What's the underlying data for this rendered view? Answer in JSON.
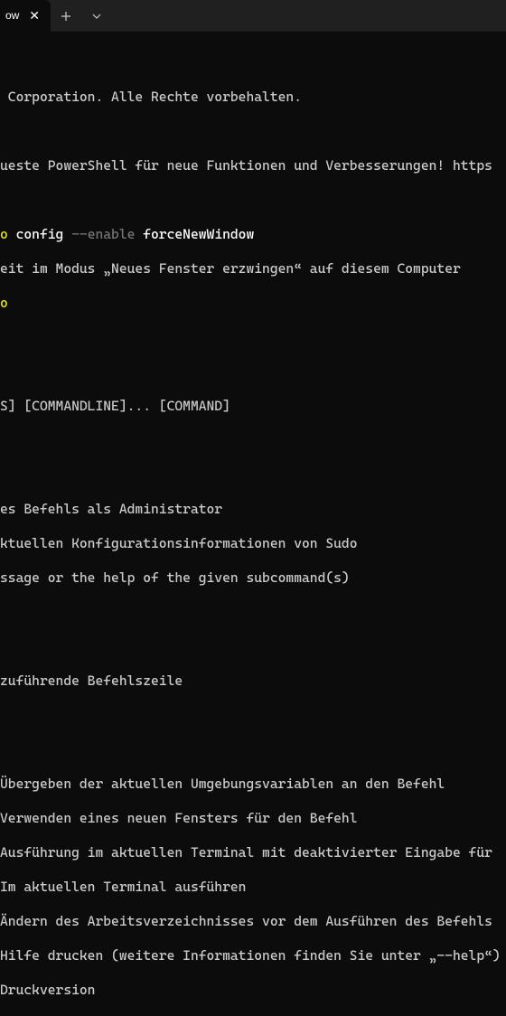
{
  "tab": {
    "title": "owe",
    "close_glyph": "✕"
  },
  "lines": {
    "l1": " Corporation. Alle Rechte vorbehalten.",
    "l2a": "ueste PowerShell für neue Funktionen und Verbesserungen! https",
    "l3_a": "o",
    "l3_b": " config ",
    "l3_c": "--enable",
    "l3_d": " forceNewWindow",
    "l4": "eit im Modus „Neues Fenster erzwingen“ auf diesem Computer",
    "l5": "o",
    "l6": "S] [COMMANDLINE]... [COMMAND]",
    "l7": "es Befehls als Administrator",
    "l8": "ktuellen Konfigurationsinformationen von Sudo",
    "l9": "ssage or the help of the given subcommand(s)",
    "l10": "zuführende Befehlszeile",
    "l11": "Übergeben der aktuellen Umgebungsvariablen an den Befehl",
    "l12": "Verwenden eines neuen Fensters für den Befehl",
    "l13": "Ausführung im aktuellen Terminal mit deaktivierter Eingabe für ",
    "l14": "Im aktuellen Terminal ausführen",
    "l15": "Ändern des Arbeitsverzeichnisses vor dem Ausführen des Befehls",
    "l16": "Hilfe drucken (weitere Informationen finden Sie unter „--help“)",
    "l17": "Druckversion"
  }
}
